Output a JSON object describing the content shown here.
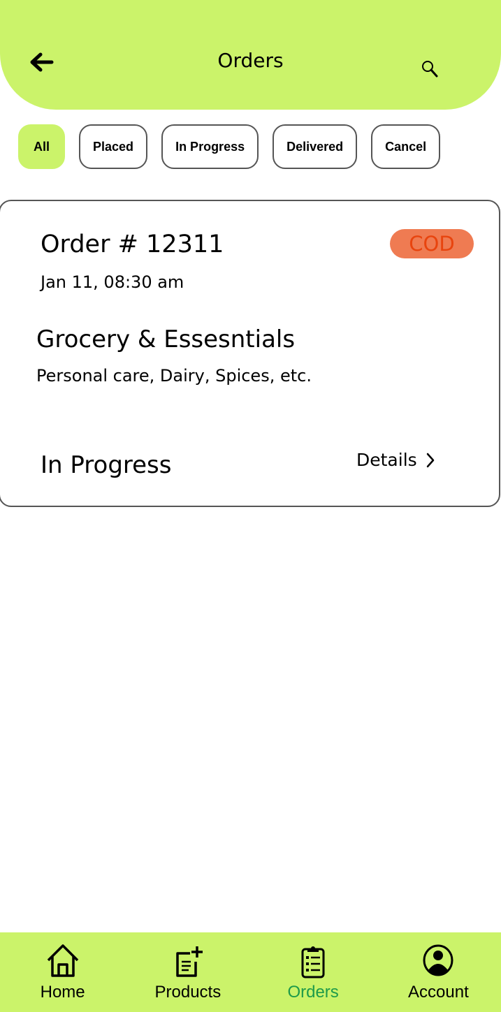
{
  "header": {
    "title": "Orders",
    "back_icon": "arrow-left-icon",
    "search_icon": "search-icon"
  },
  "filters": [
    {
      "label": "All",
      "active": true
    },
    {
      "label": "Placed",
      "active": false
    },
    {
      "label": "In Progress",
      "active": false
    },
    {
      "label": "Delivered",
      "active": false
    },
    {
      "label": "Cancel",
      "active": false
    }
  ],
  "orders": [
    {
      "order_number": "Order # 12311",
      "datetime": "Jan 11, 08:30 am",
      "payment_badge": "COD",
      "category": "Grocery & Essesntials",
      "subcategories": "Personal care, Dairy, Spices, etc.",
      "status": "In Progress",
      "details_label": "Details"
    }
  ],
  "colors": {
    "accent": "#cbf36a",
    "badge_bg": "#ef7b52",
    "badge_text": "#e8440e",
    "active_nav": "#1e9a4a"
  },
  "bottom_nav": [
    {
      "label": "Home",
      "icon": "home-icon",
      "active": false
    },
    {
      "label": "Products",
      "icon": "add-note-icon",
      "active": false
    },
    {
      "label": "Orders",
      "icon": "clipboard-list-icon",
      "active": true
    },
    {
      "label": "Account",
      "icon": "account-circle-icon",
      "active": false
    }
  ]
}
